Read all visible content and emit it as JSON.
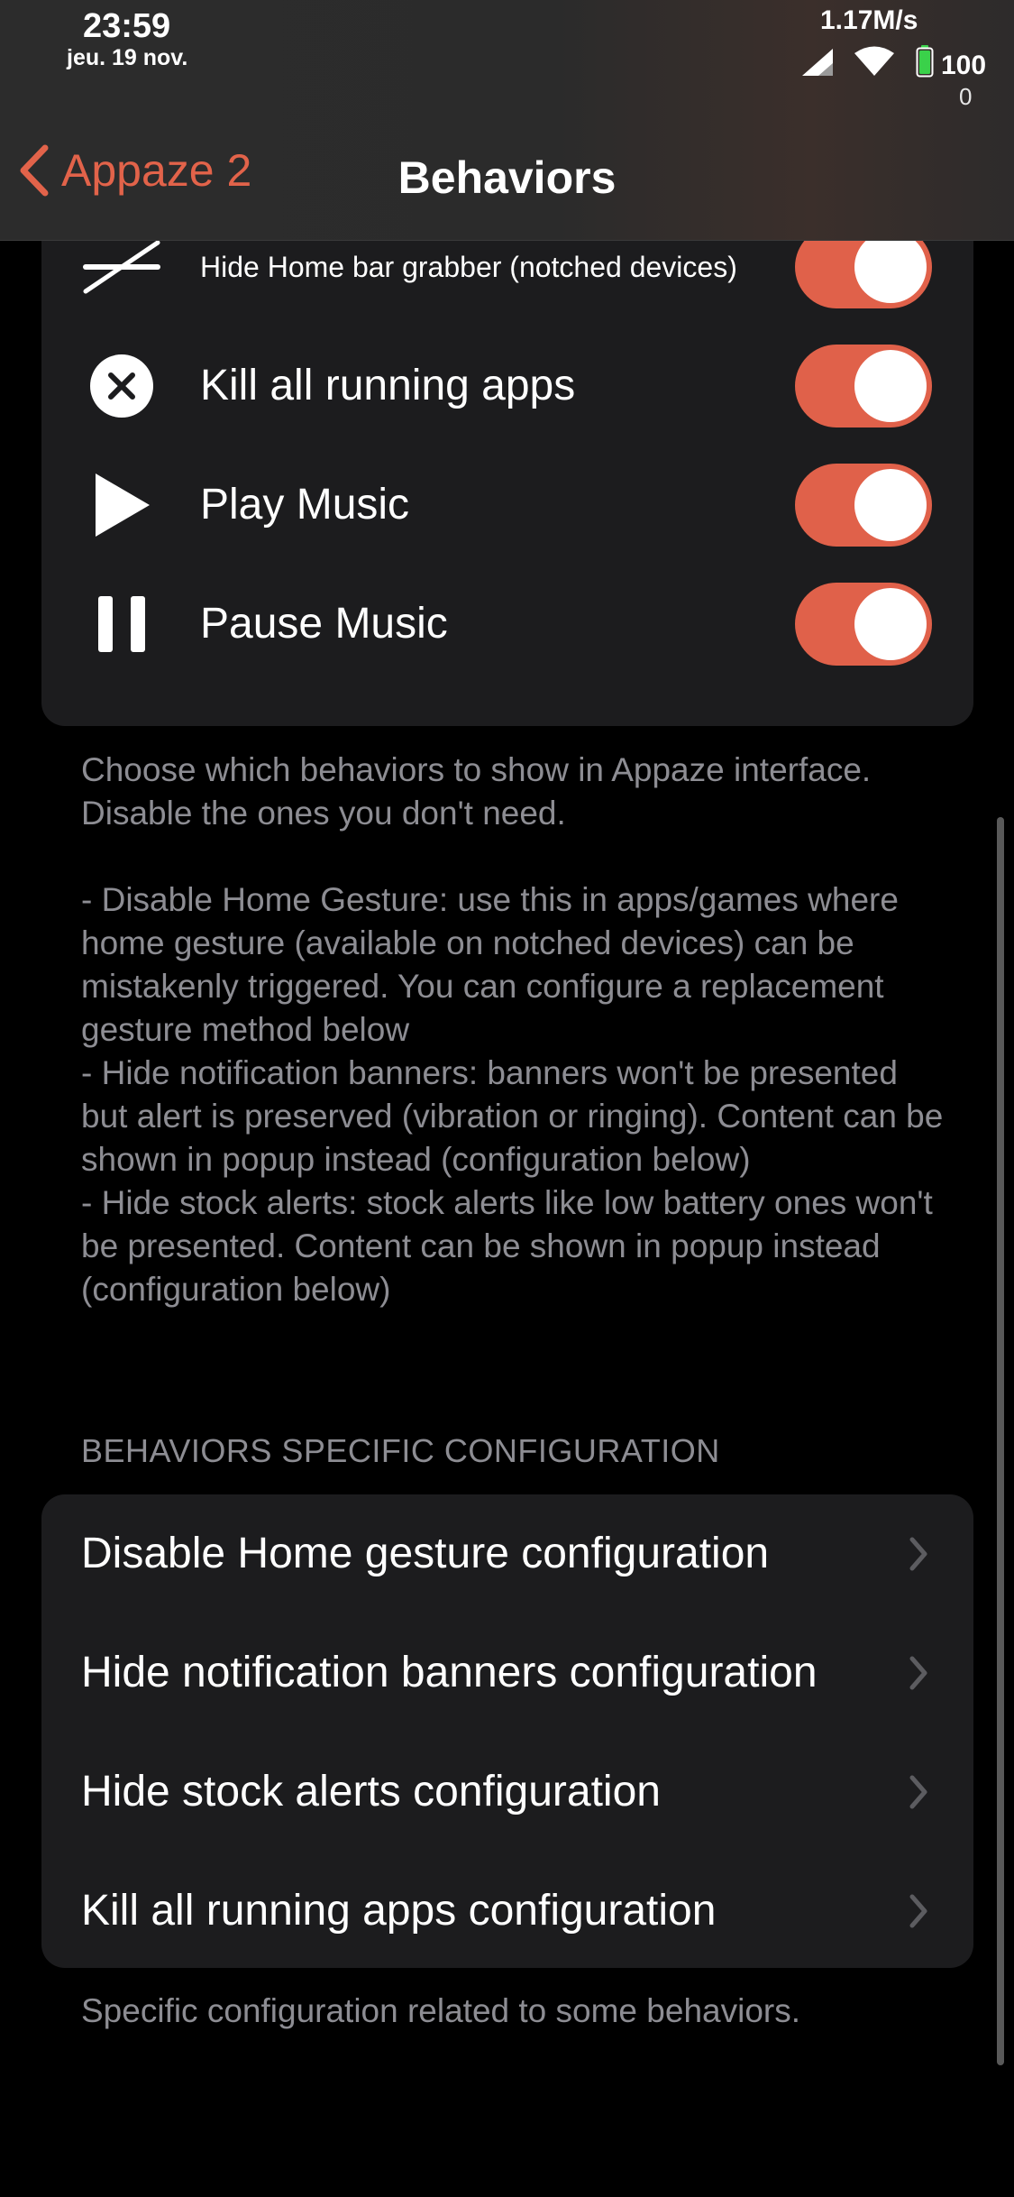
{
  "status_bar": {
    "time": "23:59",
    "date": "jeu. 19 nov.",
    "network_speed": "1.17M/s",
    "battery_level": "100",
    "sub_value": "0",
    "icons": [
      "signal-icon",
      "wifi-icon",
      "battery-icon"
    ]
  },
  "nav": {
    "back_label": "Appaze 2",
    "title": "Behaviors",
    "accent_color": "#e2634a"
  },
  "behaviors": {
    "items": [
      {
        "label": "Hide Home bar grabber (notched devices)",
        "icon": "hide-home-bar-icon",
        "enabled": true
      },
      {
        "label": "Kill all running apps",
        "icon": "close-circle-icon",
        "enabled": true
      },
      {
        "label": "Play Music",
        "icon": "play-icon",
        "enabled": true
      },
      {
        "label": "Pause Music",
        "icon": "pause-icon",
        "enabled": true
      }
    ],
    "footer": "Choose which behaviors to show in Appaze interface. Disable the ones you don't need.\n\n- Disable Home Gesture: use this in apps/games where home gesture (available on notched devices) can be mistakenly triggered. You can configure a replacement gesture method below\n- Hide notification banners: banners won't be presented but alert is preserved (vibration or ringing). Content can be shown in popup instead (configuration below)\n- Hide stock alerts: stock alerts like low battery ones won't be presented. Content can be shown in popup instead (configuration below)"
  },
  "config_section": {
    "header": "BEHAVIORS SPECIFIC CONFIGURATION",
    "items": [
      {
        "label": "Disable Home gesture configuration"
      },
      {
        "label": "Hide notification banners configuration"
      },
      {
        "label": "Hide stock alerts configuration"
      },
      {
        "label": "Kill all running apps configuration"
      }
    ],
    "footer": "Specific configuration related to some behaviors."
  },
  "colors": {
    "toggle_on": "#e0614a",
    "card_bg": "#1c1c1e",
    "secondary_text": "#8d8d93"
  }
}
